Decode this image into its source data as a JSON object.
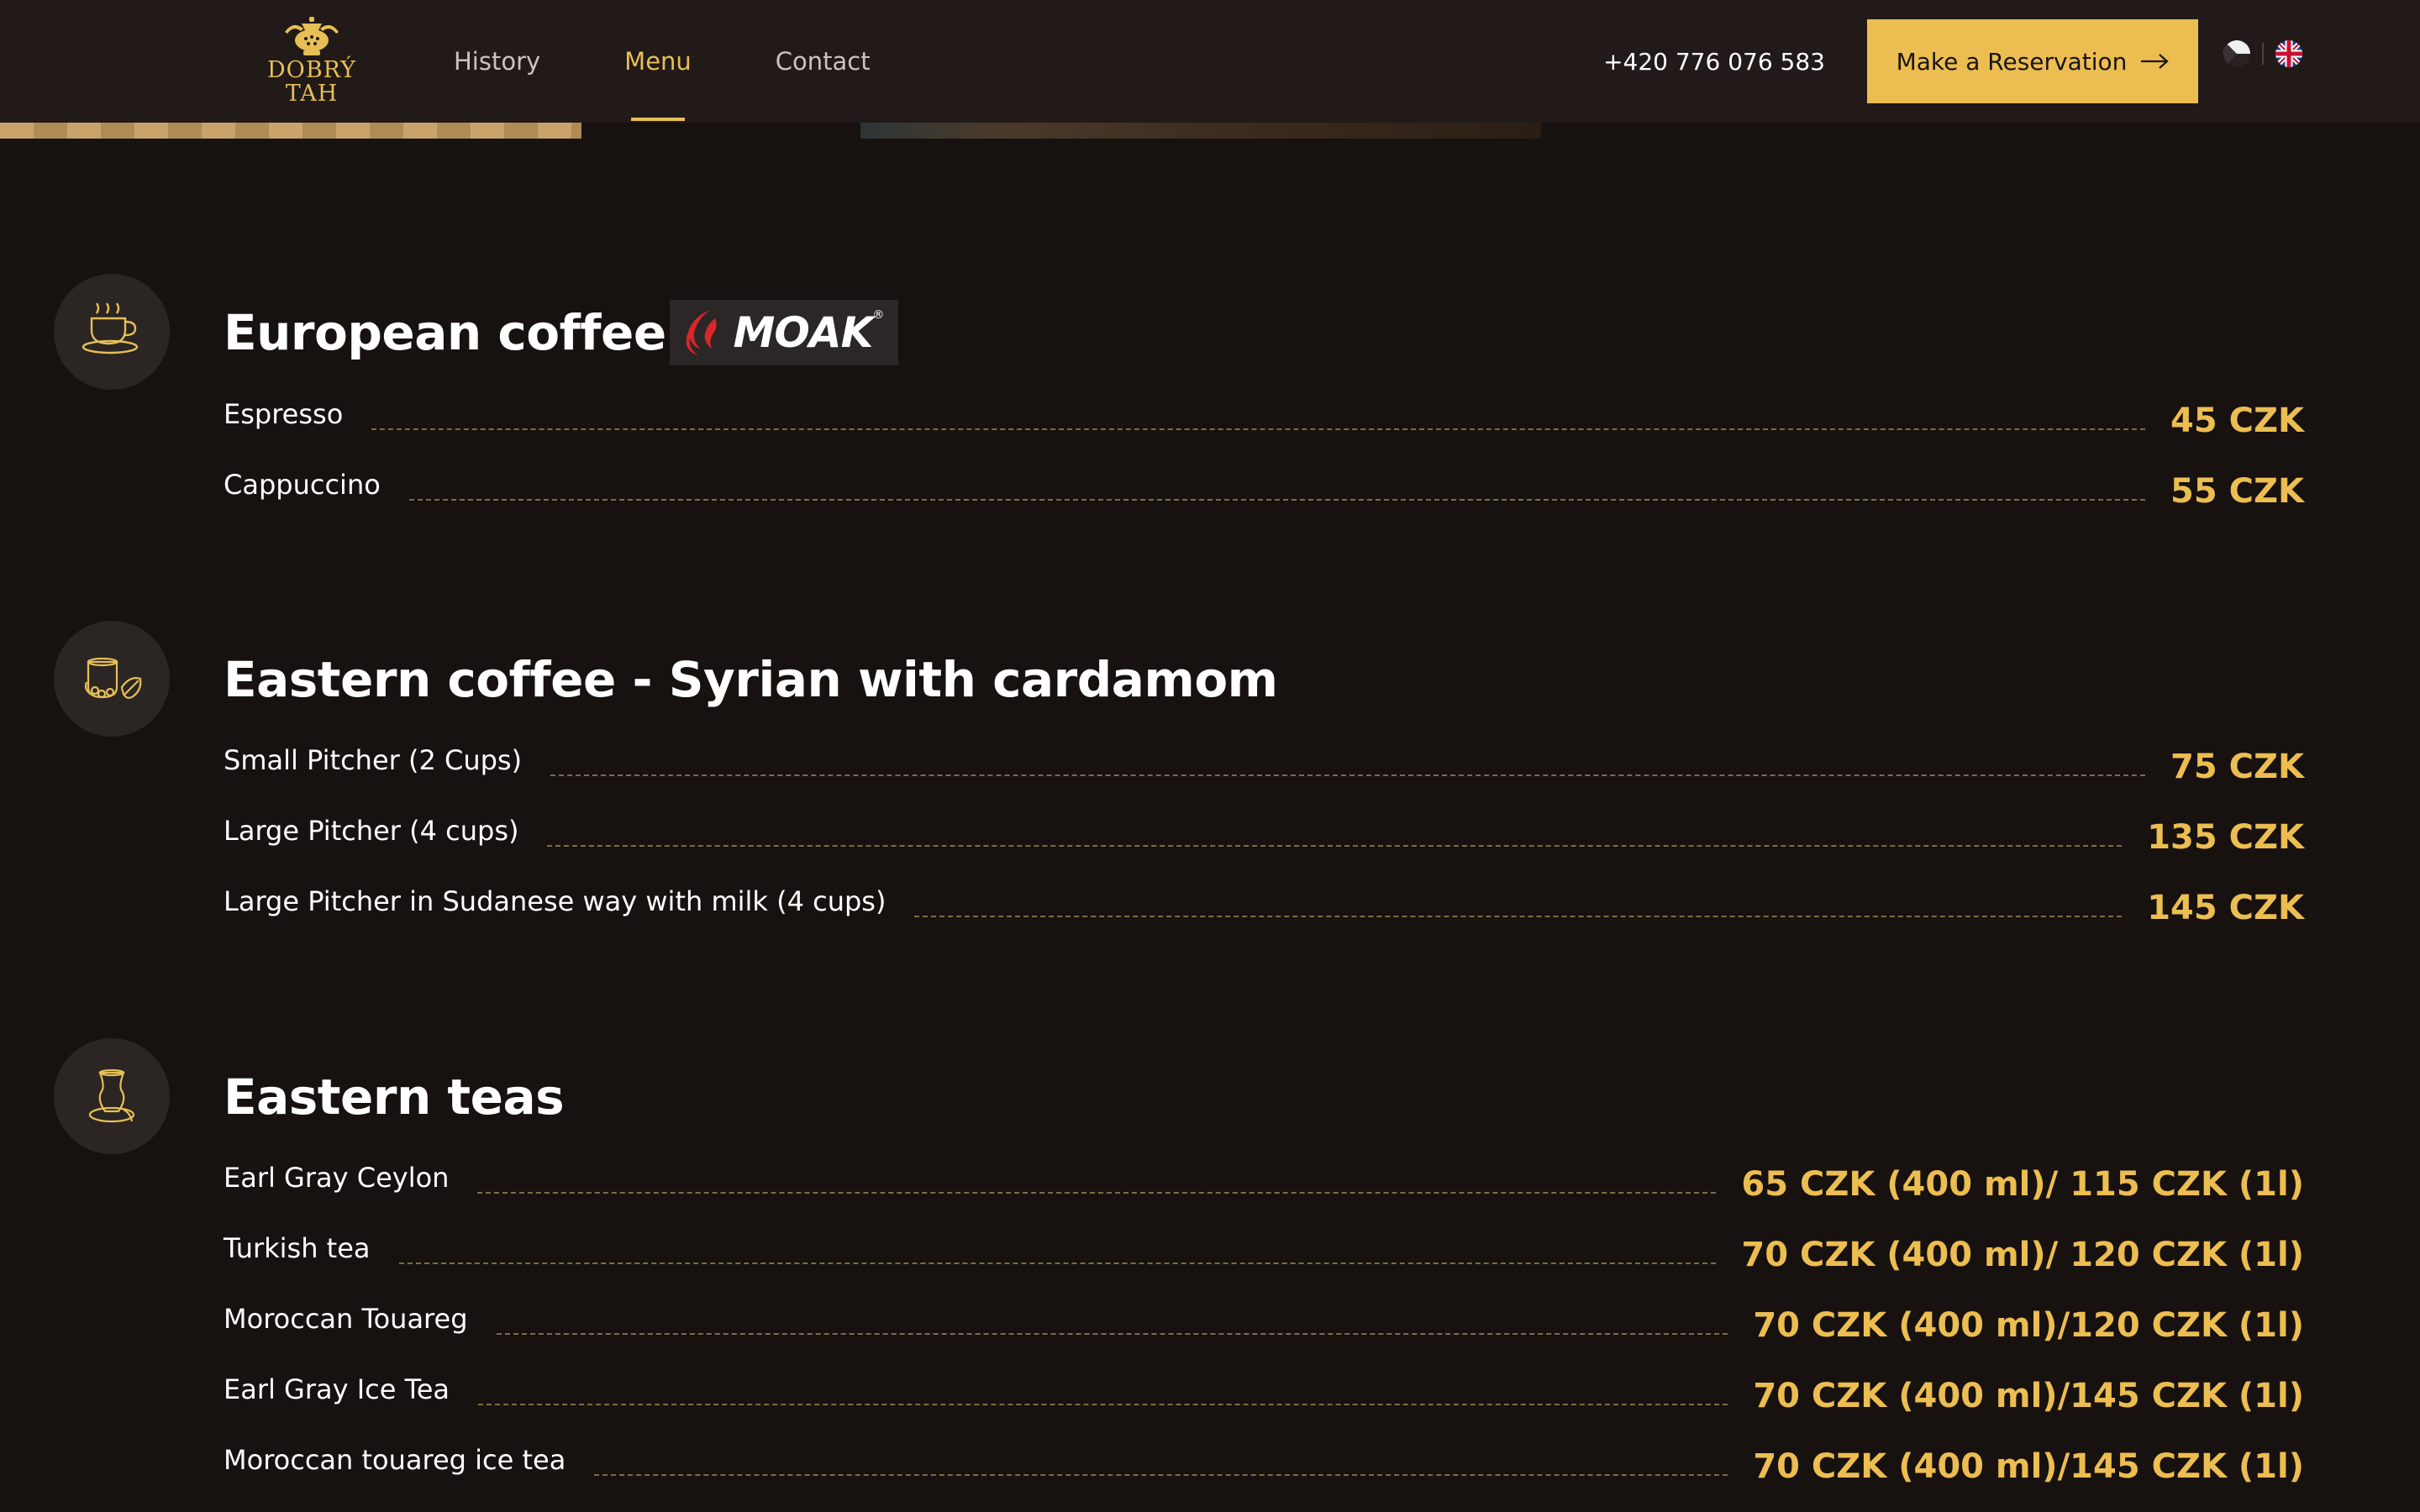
{
  "header": {
    "logo": {
      "line1": "DOBRÝ",
      "line2": "TAH"
    },
    "nav": [
      {
        "label": "History",
        "active": false
      },
      {
        "label": "Menu",
        "active": true
      },
      {
        "label": "Contact",
        "active": false
      }
    ],
    "phone": "+420 776 076 583",
    "reserve_label": "Make a Reservation",
    "languages": [
      "cz",
      "en"
    ]
  },
  "colors": {
    "background": "#171110",
    "header": "#211a18",
    "accent": "#ecbd50"
  },
  "sections": [
    {
      "title": "European coffee",
      "icon": "coffee-cup-icon",
      "brand": {
        "name": "MOAK",
        "mark": "®"
      },
      "items": [
        {
          "name": "Espresso",
          "price": "45 CZK"
        },
        {
          "name": "Cappuccino",
          "price": "55 CZK"
        }
      ]
    },
    {
      "title": "Eastern coffee - Syrian with cardamom",
      "icon": "cardamom-jar-icon",
      "items": [
        {
          "name": "Small Pitcher (2 Cups)",
          "price": "75 CZK"
        },
        {
          "name": "Large Pitcher (4 cups)",
          "price": "135 CZK"
        },
        {
          "name": "Large Pitcher in Sudanese way with milk (4 cups)",
          "price": "145 CZK"
        }
      ]
    },
    {
      "title": "Eastern teas",
      "icon": "tea-glass-icon",
      "items": [
        {
          "name": "Earl Gray Ceylon",
          "price": "65 CZK (400 ml)/ 115 CZK (1l)"
        },
        {
          "name": "Turkish tea",
          "price": "70 CZK (400 ml)/ 120 CZK (1l)"
        },
        {
          "name": "Moroccan Touareg",
          "price": "70 CZK (400 ml)/120 CZK (1l)"
        },
        {
          "name": "Earl Gray Ice Tea",
          "price": "70 CZK (400 ml)/145 CZK (1l)"
        },
        {
          "name": "Moroccan touareg ice tea",
          "price": "70 CZK (400 ml)/145 CZK (1l)"
        }
      ]
    }
  ]
}
